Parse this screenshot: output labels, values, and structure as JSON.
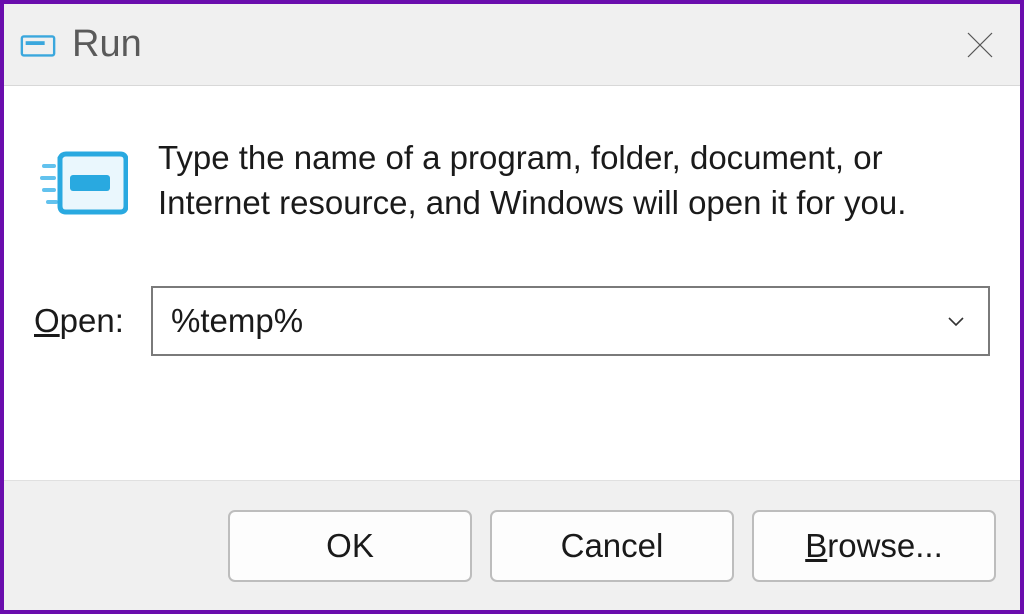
{
  "dialog": {
    "title": "Run",
    "description": "Type the name of a program, folder, document, or Internet resource, and Windows will open it for you.",
    "open_label_pre": "O",
    "open_label_post": "pen:",
    "input_value": "%temp%",
    "buttons": {
      "ok": "OK",
      "cancel": "Cancel",
      "browse_pre": "B",
      "browse_post": "rowse..."
    },
    "colors": {
      "border": "#6a0dad",
      "titlebar_bg": "#f0f0f0",
      "icon_accent": "#29a9e0"
    }
  }
}
